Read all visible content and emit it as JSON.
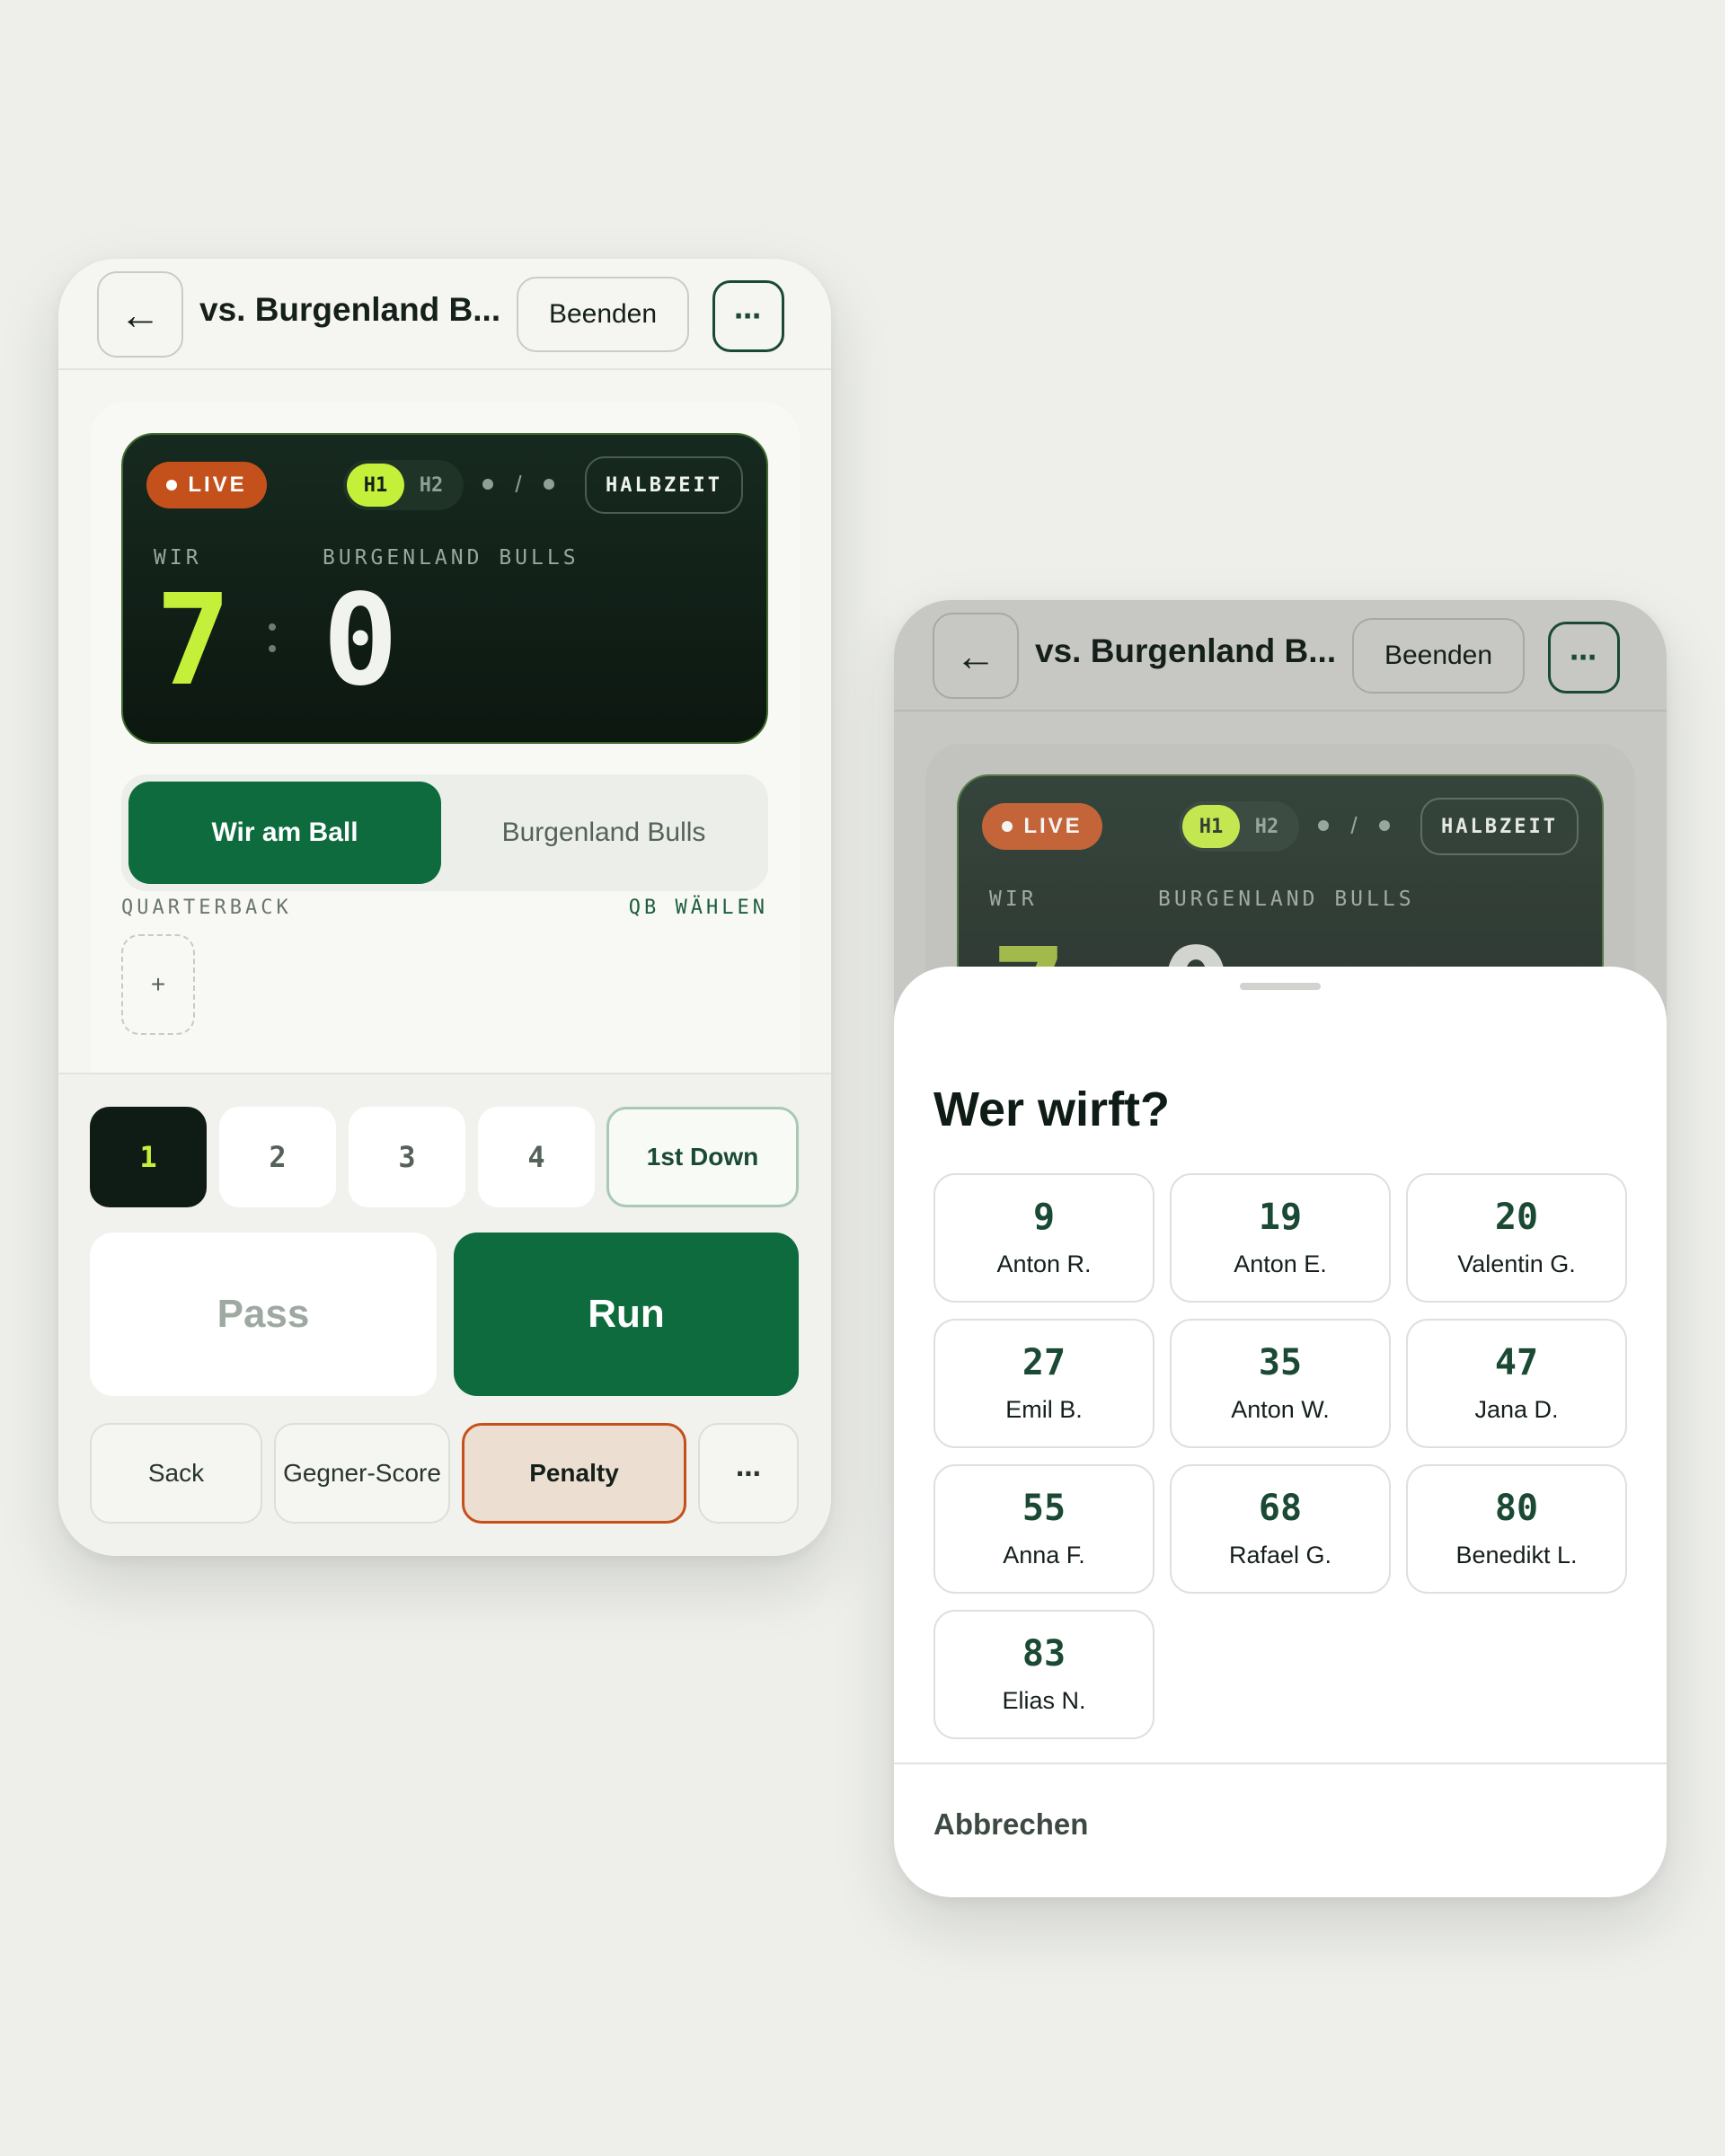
{
  "header": {
    "title": "vs. Burgenland B...",
    "end_label": "Beenden",
    "more_label": "⋯",
    "back_label": "←"
  },
  "scoreboard": {
    "live_label": "LIVE",
    "halves": [
      "H1",
      "H2"
    ],
    "active_half": "H1",
    "timer_separator": "/",
    "halftime_label": "HALBZEIT",
    "home_label": "WIR",
    "away_label": "BURGENLAND BULLS",
    "home_score": "7",
    "away_score": "0"
  },
  "possession": {
    "ours": "Wir am Ball",
    "theirs": "Burgenland Bulls",
    "active": "ours"
  },
  "quarterback": {
    "label": "QUARTERBACK",
    "choose_label": "QB WÄHLEN",
    "add_label": "+"
  },
  "downs": {
    "items": [
      "1",
      "2",
      "3",
      "4"
    ],
    "active": "1",
    "first_down_label": "1st Down"
  },
  "plays": {
    "pass": "Pass",
    "run": "Run"
  },
  "minor_actions": {
    "sack": "Sack",
    "opponent_score": "Gegner-Score",
    "penalty": "Penalty",
    "more": "⋯"
  },
  "sheet": {
    "title": "Wer wirft?",
    "cancel_label": "Abbrechen",
    "players": [
      {
        "number": "9",
        "name": "Anton R."
      },
      {
        "number": "19",
        "name": "Anton E."
      },
      {
        "number": "20",
        "name": "Valentin G."
      },
      {
        "number": "27",
        "name": "Emil B."
      },
      {
        "number": "35",
        "name": "Anton W."
      },
      {
        "number": "47",
        "name": "Jana D."
      },
      {
        "number": "55",
        "name": "Anna F."
      },
      {
        "number": "68",
        "name": "Rafael G."
      },
      {
        "number": "80",
        "name": "Benedikt L."
      },
      {
        "number": "83",
        "name": "Elias N."
      }
    ]
  },
  "colors": {
    "accent_green": "#0d6b3e",
    "lime": "#c5f03a",
    "live_orange": "#c4511c",
    "scoreboard_bg": "#0c1710"
  }
}
